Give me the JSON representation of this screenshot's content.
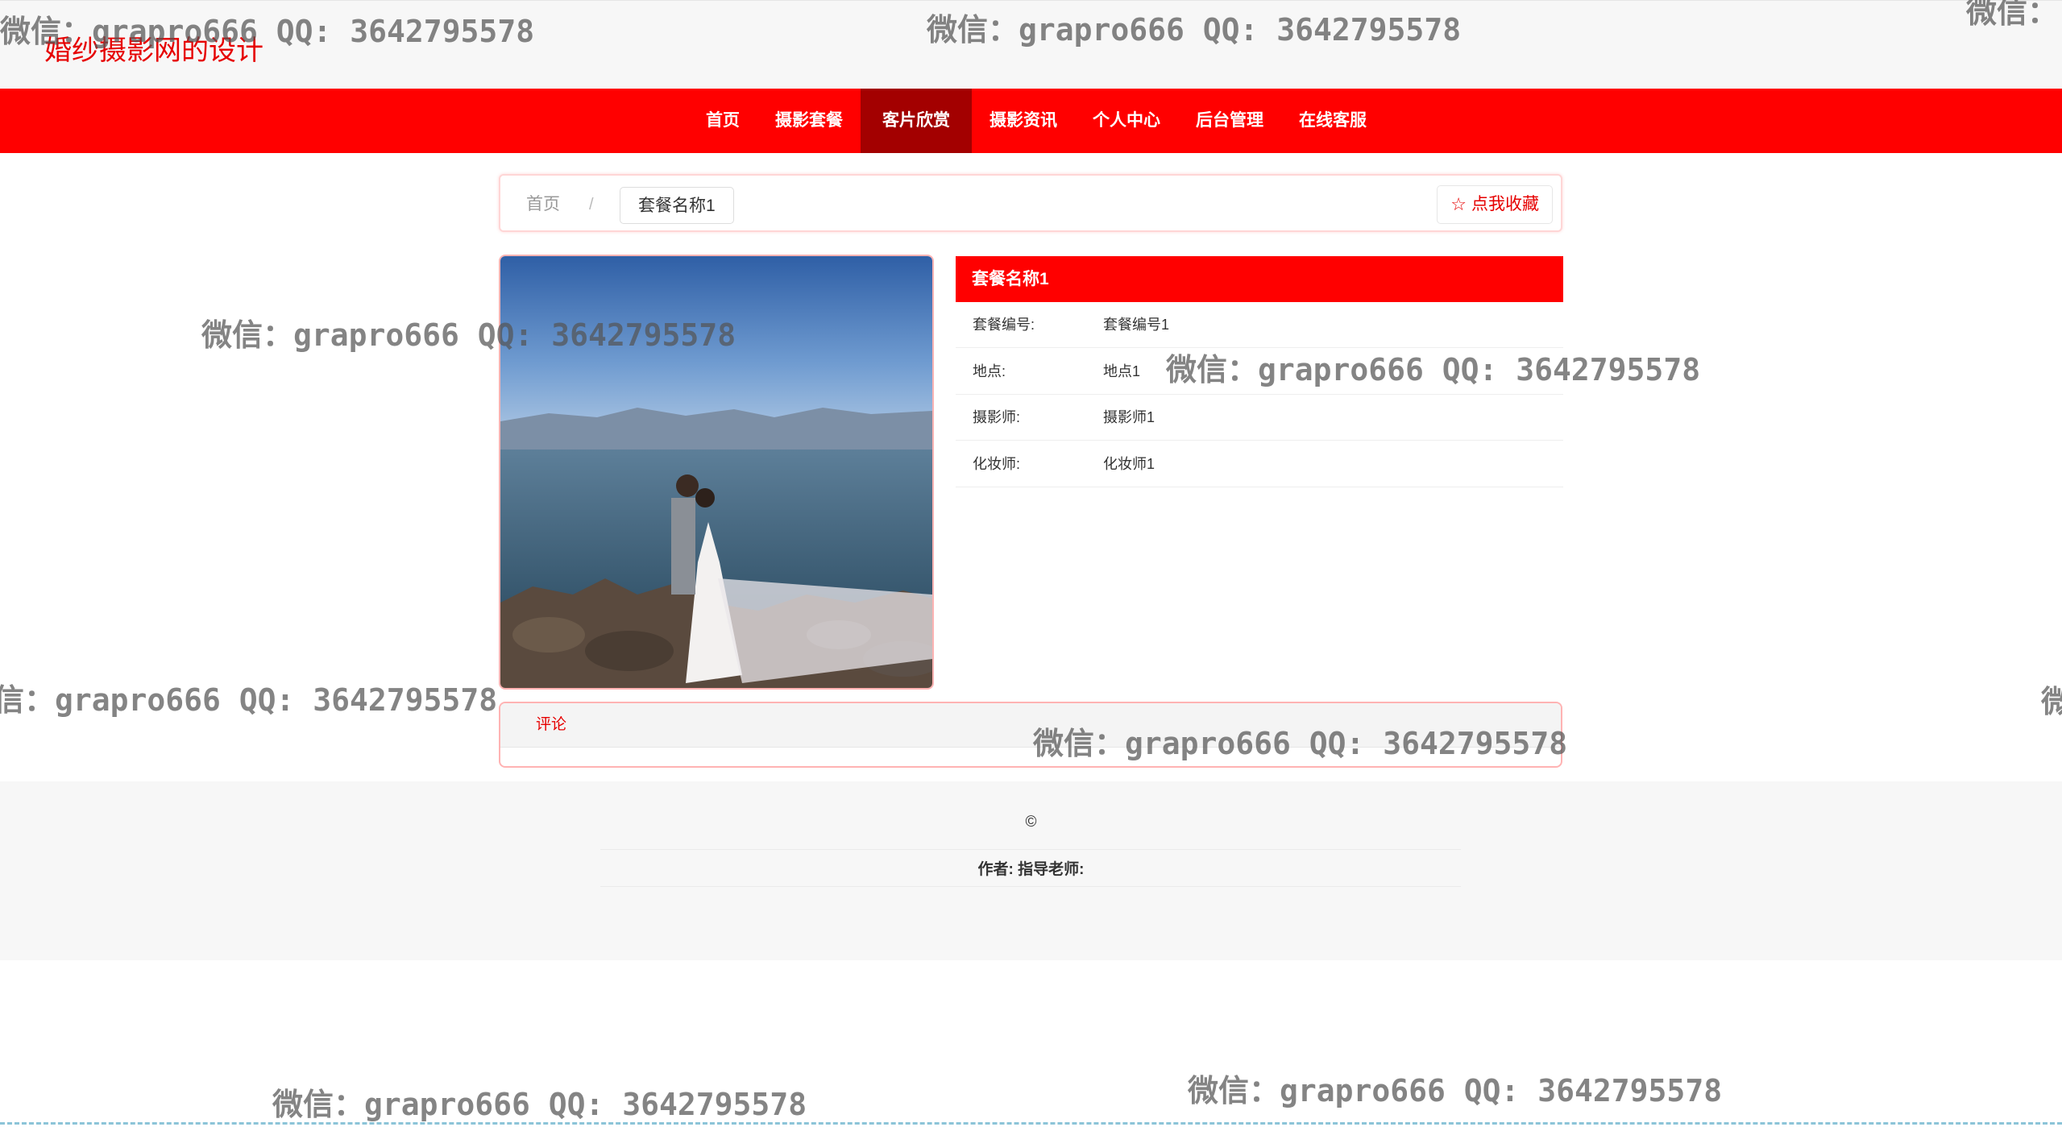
{
  "site": {
    "title": "婚纱摄影网的设计"
  },
  "nav": {
    "items": [
      {
        "label": "首页"
      },
      {
        "label": "摄影套餐"
      },
      {
        "label": "客片欣赏"
      },
      {
        "label": "摄影资讯"
      },
      {
        "label": "个人中心"
      },
      {
        "label": "后台管理"
      },
      {
        "label": "在线客服"
      }
    ],
    "active": "客片欣赏"
  },
  "breadcrumb": {
    "home": "首页",
    "separator": "/",
    "current": "套餐名称1"
  },
  "favorite": {
    "label": "点我收藏",
    "icon": "star-icon"
  },
  "photo": {
    "description_icon": "wedding-photo"
  },
  "detail": {
    "title": "套餐名称1",
    "rows": [
      {
        "key": "套餐编号:",
        "value": "套餐编号1"
      },
      {
        "key": "地点:",
        "value": "地点1"
      },
      {
        "key": "摄影师:",
        "value": "摄影师1"
      },
      {
        "key": "化妆师:",
        "value": "化妆师1"
      }
    ]
  },
  "comments": {
    "tab_label": "评论"
  },
  "footer": {
    "copyright": "©",
    "info": "作者:  指导老师:"
  },
  "watermark": {
    "text": "微信：grapro666 QQ: 3642795578",
    "partial_left": "信：grapro666 QQ: 3642795578",
    "partial_right": "微信：",
    "partial_right2": "微"
  },
  "colors": {
    "brand": "#ff0000",
    "nav_active": "#a30000",
    "footer_bg": "#f7f7f7"
  }
}
